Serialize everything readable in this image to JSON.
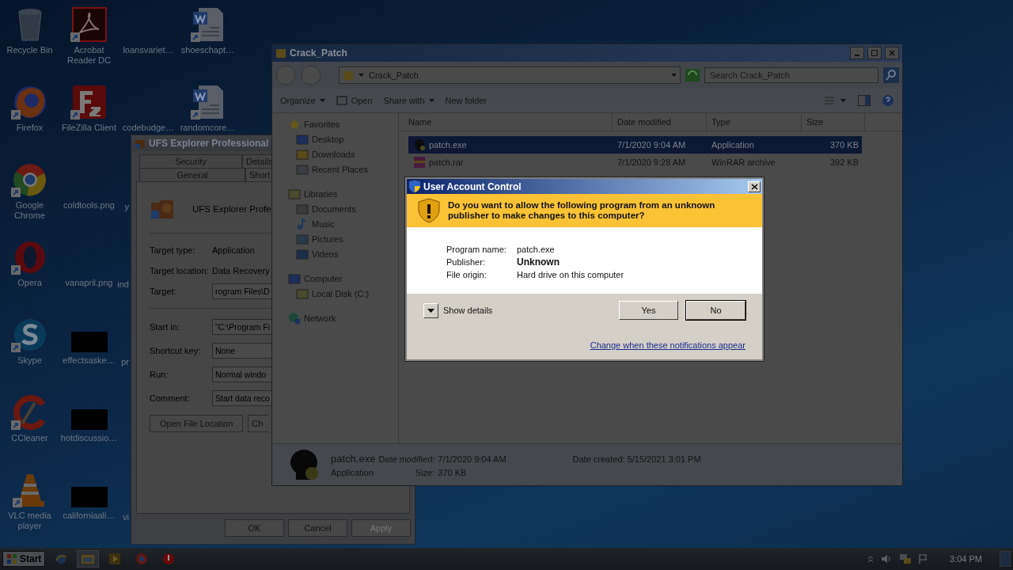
{
  "desktop": {
    "columns": [
      [
        {
          "label": "Recycle Bin",
          "kind": "bin"
        },
        {
          "label": "Firefox",
          "kind": "firefox"
        },
        {
          "label": "Google Chrome",
          "kind": "chrome"
        },
        {
          "label": "Opera",
          "kind": "opera"
        },
        {
          "label": "Skype",
          "kind": "skype"
        },
        {
          "label": "CCleaner",
          "kind": "ccleaner"
        },
        {
          "label": "VLC media player",
          "kind": "vlc"
        }
      ],
      [
        {
          "label": "Acrobat Reader DC",
          "kind": "pdf"
        },
        {
          "label": "FileZilla Client",
          "kind": "filezilla"
        },
        {
          "label": "coldtools.png",
          "kind": "image"
        },
        {
          "label": "vanapril.png",
          "kind": "image"
        },
        {
          "label": "effectsaske…",
          "kind": "black"
        },
        {
          "label": "hotdiscussio…",
          "kind": "black"
        },
        {
          "label": "californiaali…",
          "kind": "black"
        }
      ],
      [
        {
          "label": "loansvariet…",
          "kind": "image"
        },
        {
          "label": "codebudge…",
          "kind": "image"
        },
        {
          "label": "y",
          "kind": "clipped"
        },
        {
          "label": "ind",
          "kind": "clipped"
        },
        {
          "label": "pr",
          "kind": "clipped"
        },
        {
          "kind": "gap"
        },
        {
          "label": "vi",
          "kind": "clipped"
        }
      ],
      [
        {
          "label": "shoeschapt…",
          "kind": "word"
        },
        {
          "label": "randomcore…",
          "kind": "word"
        }
      ]
    ]
  },
  "properties_window": {
    "title": "UFS Explorer Professional",
    "tabs_back": [
      {
        "label": "Security",
        "selected": false
      },
      {
        "label": "Details",
        "selected": false
      }
    ],
    "tabs_front": [
      {
        "label": "General",
        "selected": false
      },
      {
        "label": "Short",
        "selected": true
      }
    ],
    "name": "UFS Explorer Profe",
    "info": [
      {
        "label": "Target type:",
        "value": "Application"
      },
      {
        "label": "Target location:",
        "value": "Data Recovery"
      }
    ],
    "target": {
      "label": "Target:",
      "value": "rogram Files\\D"
    },
    "fields": [
      {
        "label": "Start in:",
        "value": "\"C:\\Program Fi"
      },
      {
        "label": "Shortcut key:",
        "value": "None"
      },
      {
        "label": "Run:",
        "value": "Normal windo"
      },
      {
        "label": "Comment:",
        "value": "Start data reco"
      }
    ],
    "buttons": [
      "Open File Location",
      "Ch"
    ],
    "footer_buttons": [
      {
        "label": "OK",
        "disabled": false
      },
      {
        "label": "Cancel",
        "disabled": false
      },
      {
        "label": "Apply",
        "disabled": true
      }
    ]
  },
  "explorer": {
    "title": "Crack_Patch",
    "address": "Crack_Patch",
    "search": {
      "placeholder": "Search Crack_Patch"
    },
    "toolbar": [
      {
        "label": "Organize",
        "kind": "menu"
      },
      {
        "label": "Open",
        "kind": "open"
      },
      {
        "label": "Share with",
        "kind": "menu"
      },
      {
        "label": "New folder",
        "kind": "plain"
      }
    ],
    "nav": [
      {
        "label": "Favorites",
        "kind": "star",
        "children": [
          {
            "label": "Desktop",
            "kind": "desktop"
          },
          {
            "label": "Downloads",
            "kind": "downloads"
          },
          {
            "label": "Recent Places",
            "kind": "recent"
          }
        ]
      },
      {
        "label": "Libraries",
        "kind": "library",
        "children": [
          {
            "label": "Documents",
            "kind": "documents"
          },
          {
            "label": "Music",
            "kind": "music"
          },
          {
            "label": "Pictures",
            "kind": "pictures"
          },
          {
            "label": "Videos",
            "kind": "videos"
          }
        ]
      },
      {
        "label": "Computer",
        "kind": "computer",
        "children": [
          {
            "label": "Local Disk (C:)",
            "kind": "disk"
          }
        ]
      },
      {
        "label": "Network",
        "kind": "network"
      }
    ],
    "columns": [
      "Name",
      "Date modified",
      "Type",
      "Size"
    ],
    "rows": [
      {
        "name": "patch.exe",
        "kind": "exe",
        "date": "7/1/2020 9:04 AM",
        "type": "Application",
        "size": "370 KB",
        "selected": true
      },
      {
        "name": "patch.rar",
        "kind": "rar",
        "date": "7/1/2020 9:28 AM",
        "type": "WinRAR archive",
        "size": "392 KB",
        "selected": false
      }
    ],
    "details": {
      "name": "patch.exe",
      "kind_text": "Application",
      "modified_label": "Date modified:",
      "modified": "7/1/2020 9:04 AM",
      "created_label": "Date created:",
      "created": "5/15/2021 3:01 PM",
      "size_label": "Size:",
      "size": "370 KB"
    }
  },
  "uac": {
    "title": "User Account Control",
    "question": "Do you want to allow the following program from an unknown publisher to make changes to this computer?",
    "fields": [
      {
        "label": "Program name:",
        "value": "patch.exe",
        "bold": false
      },
      {
        "label": "Publisher:",
        "value": "Unknown",
        "bold": true
      },
      {
        "label": "File origin:",
        "value": "Hard drive on this computer",
        "bold": false
      }
    ],
    "show_details": "Show details",
    "buttons": [
      {
        "label": "Yes",
        "default": false
      },
      {
        "label": "No",
        "default": true
      }
    ],
    "link": "Change when these notifications appear"
  },
  "taskbar": {
    "start": "Start",
    "apps": [
      {
        "kind": "ie",
        "selected": false
      },
      {
        "kind": "explorer",
        "selected": true
      },
      {
        "kind": "media",
        "selected": false
      },
      {
        "kind": "chrome",
        "selected": false
      },
      {
        "kind": "redcircle",
        "selected": false
      }
    ],
    "clock": "3:04 PM"
  }
}
